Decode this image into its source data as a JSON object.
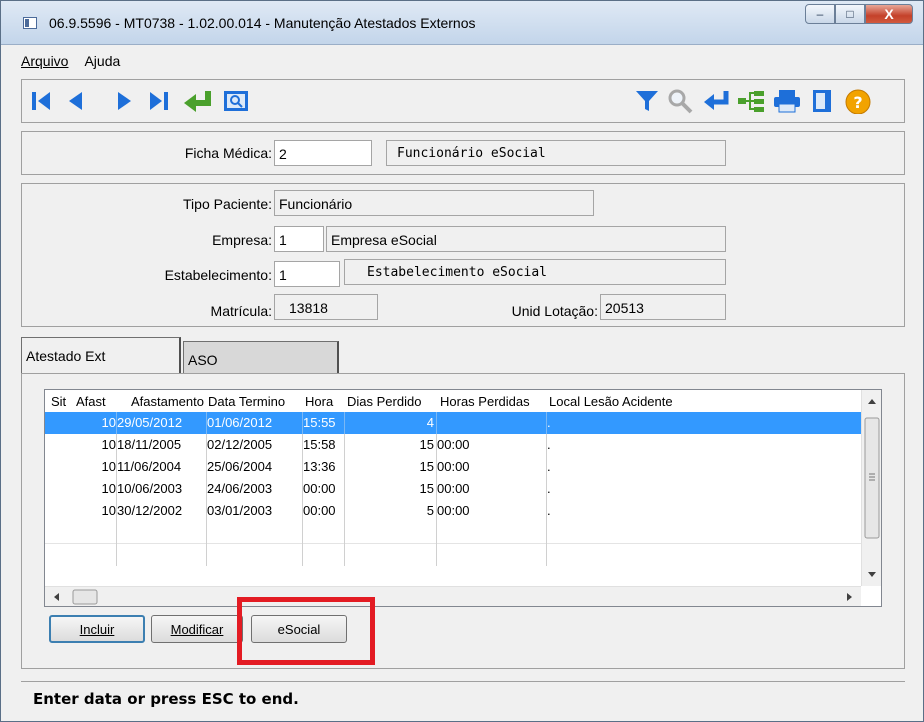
{
  "window": {
    "title": "06.9.5596 - MT0738 - 1.02.00.014 - Manutenção Atestados Externos",
    "controls": [
      "–",
      "□",
      "X"
    ]
  },
  "menu": [
    {
      "label": "Arquivo"
    },
    {
      "label": "Ajuda"
    }
  ],
  "toolbar": {
    "left_icons": [
      "first-record-icon",
      "previous-record-icon",
      "next-record-icon",
      "last-record-icon",
      "return-icon",
      "search-screen-icon"
    ],
    "right_icons": [
      "filter-icon",
      "magnifier-icon",
      "enter-icon",
      "tree-icon",
      "print-icon",
      "exit-door-icon",
      "help-icon"
    ]
  },
  "ficha": {
    "label": "Ficha Médica:",
    "value": "2",
    "description": "Funcionário eSocial"
  },
  "details": {
    "tipo_label": "Tipo Paciente:",
    "tipo_value": "Funcionário",
    "empresa_label": "Empresa:",
    "empresa_code": "1",
    "empresa_name": "Empresa eSocial",
    "estab_label": "Estabelecimento:",
    "estab_code": "1",
    "estab_name": "Estabelecimento eSocial",
    "matricula_label": "Matrícula:",
    "matricula_value": "13818",
    "unid_label": "Unid Lotação:",
    "unid_value": "20513"
  },
  "tabs": [
    {
      "label": "Atestado Ext",
      "active": true
    },
    {
      "label": "ASO",
      "active": false
    }
  ],
  "grid": {
    "columns": [
      "Sit",
      "Afast",
      "Afastamento",
      "Data Termino",
      "Hora",
      "Dias Perdido",
      "Horas Perdidas",
      "Local Lesão Acidente"
    ],
    "rows": [
      {
        "sit": "10",
        "afastamento": "29/05/2012",
        "termino": "01/06/2012",
        "hora": "15:55",
        "dias": "4",
        "horas": "",
        "local": "."
      },
      {
        "sit": "10",
        "afastamento": "18/11/2005",
        "termino": "02/12/2005",
        "hora": "15:58",
        "dias": "15",
        "horas": "00:00",
        "local": "."
      },
      {
        "sit": "10",
        "afastamento": "11/06/2004",
        "termino": "25/06/2004",
        "hora": "13:36",
        "dias": "15",
        "horas": "00:00",
        "local": "."
      },
      {
        "sit": "10",
        "afastamento": "10/06/2003",
        "termino": "24/06/2003",
        "hora": "00:00",
        "dias": "15",
        "horas": "00:00",
        "local": "."
      },
      {
        "sit": "10",
        "afastamento": "30/12/2002",
        "termino": "03/01/2003",
        "hora": "00:00",
        "dias": "5",
        "horas": "00:00",
        "local": "."
      }
    ]
  },
  "buttons": {
    "incluir": "Incluir",
    "modificar": "Modificar",
    "esocial": "eSocial"
  },
  "status": "Enter data or press ESC to end.",
  "colors": {
    "selection": "#3399ff",
    "highlight_box": "#e31b23",
    "toolbar_blue": "#1e6fd9",
    "toolbar_green": "#4aa02c"
  }
}
